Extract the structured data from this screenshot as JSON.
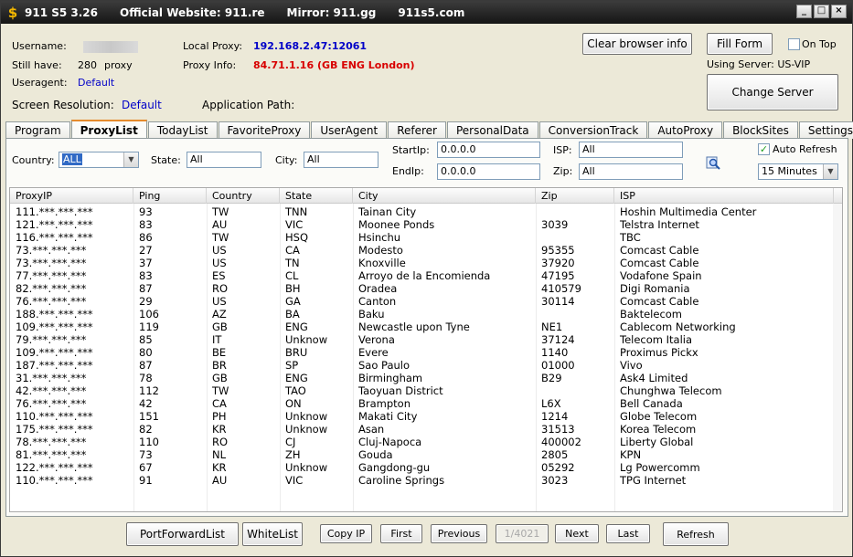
{
  "titlebar": {
    "app": "911 S5 3.26",
    "website": "Official Website:  911.re",
    "mirror": "Mirror:  911.gg",
    "alt": "911s5.com",
    "logo_icon": "dollar-icon"
  },
  "info": {
    "username_label": "Username:",
    "still_have_label": "Still have:",
    "still_have_value": "280",
    "still_have_unit": "proxy",
    "useragent_label": "Useragent:",
    "useragent_value": "Default",
    "local_proxy_label": "Local Proxy:",
    "local_proxy_value": "192.168.2.47:12061",
    "proxy_info_label": "Proxy Info:",
    "proxy_info_value": "84.71.1.16 (GB ENG London)",
    "screen_res_label": "Screen Resolution:",
    "screen_res_value": "Default",
    "app_path_label": "Application Path:",
    "using_server": "Using Server: US-VIP"
  },
  "buttons": {
    "clear_browser": "Clear browser info",
    "fill_form": "Fill Form",
    "on_top": "On Top",
    "change_server": "Change Server"
  },
  "tabs": [
    "Program",
    "ProxyList",
    "TodayList",
    "FavoriteProxy",
    "UserAgent",
    "Referer",
    "PersonalData",
    "ConversionTrack",
    "AutoProxy",
    "BlockSites",
    "Settings"
  ],
  "active_tab": "ProxyList",
  "filters": {
    "country_label": "Country:",
    "country_value": "ALL",
    "state_label": "State:",
    "state_value": "All",
    "city_label": "City:",
    "city_value": "All",
    "startip_label": "StartIp:",
    "startip_value": "0.0.0.0",
    "endip_label": "EndIp:",
    "endip_value": "0.0.0.0",
    "isp_label": "ISP:",
    "isp_value": "All",
    "zip_label": "Zip:",
    "zip_value": "All",
    "auto_refresh_label": "Auto Refresh",
    "auto_refresh_checked": true,
    "interval_value": "15 Minutes",
    "search_icon": "search-icon"
  },
  "table": {
    "columns": [
      "ProxyIP",
      "Ping",
      "Country",
      "State",
      "City",
      "Zip",
      "ISP"
    ],
    "rows": [
      [
        "111.***.***.***",
        "93",
        "TW",
        "TNN",
        "Tainan City",
        "",
        "Hoshin Multimedia Center"
      ],
      [
        "121.***.***.***",
        "83",
        "AU",
        "VIC",
        "Moonee Ponds",
        "3039",
        "Telstra Internet"
      ],
      [
        "116.***.***.***",
        "86",
        "TW",
        "HSQ",
        "Hsinchu",
        "",
        "TBC"
      ],
      [
        "73.***.***.***",
        "27",
        "US",
        "CA",
        "Modesto",
        "95355",
        "Comcast Cable"
      ],
      [
        "73.***.***.***",
        "37",
        "US",
        "TN",
        "Knoxville",
        "37920",
        "Comcast Cable"
      ],
      [
        "77.***.***.***",
        "83",
        "ES",
        "CL",
        "Arroyo de la Encomienda",
        "47195",
        "Vodafone Spain"
      ],
      [
        "82.***.***.***",
        "87",
        "RO",
        "BH",
        "Oradea",
        "410579",
        "Digi Romania"
      ],
      [
        "76.***.***.***",
        "29",
        "US",
        "GA",
        "Canton",
        "30114",
        "Comcast Cable"
      ],
      [
        "188.***.***.***",
        "106",
        "AZ",
        "BA",
        "Baku",
        "",
        "Baktelecom"
      ],
      [
        "109.***.***.***",
        "119",
        "GB",
        "ENG",
        "Newcastle upon Tyne",
        "NE1",
        "Cablecom Networking"
      ],
      [
        "79.***.***.***",
        "85",
        "IT",
        "Unknow",
        "Verona",
        "37124",
        "Telecom Italia"
      ],
      [
        "109.***.***.***",
        "80",
        "BE",
        "BRU",
        "Evere",
        "1140",
        "Proximus Pickx"
      ],
      [
        "187.***.***.***",
        "87",
        "BR",
        "SP",
        "Sao Paulo",
        "01000",
        "Vivo"
      ],
      [
        "31.***.***.***",
        "78",
        "GB",
        "ENG",
        "Birmingham",
        "B29",
        "Ask4 Limited"
      ],
      [
        "42.***.***.***",
        "112",
        "TW",
        "TAO",
        "Taoyuan District",
        "",
        "Chunghwa Telecom"
      ],
      [
        "76.***.***.***",
        "42",
        "CA",
        "ON",
        "Brampton",
        "L6X",
        "Bell Canada"
      ],
      [
        "110.***.***.***",
        "151",
        "PH",
        "Unknow",
        "Makati City",
        "1214",
        "Globe Telecom"
      ],
      [
        "175.***.***.***",
        "82",
        "KR",
        "Unknow",
        "Asan",
        "31513",
        "Korea Telecom"
      ],
      [
        "78.***.***.***",
        "110",
        "RO",
        "CJ",
        "Cluj-Napoca",
        "400002",
        "Liberty Global"
      ],
      [
        "81.***.***.***",
        "73",
        "NL",
        "ZH",
        "Gouda",
        "2805",
        "KPN"
      ],
      [
        "122.***.***.***",
        "67",
        "KR",
        "Unknow",
        "Gangdong-gu",
        "05292",
        "Lg Powercomm"
      ],
      [
        "110.***.***.***",
        "91",
        "AU",
        "VIC",
        "Caroline Springs",
        "3023",
        "TPG Internet"
      ]
    ]
  },
  "bottom": {
    "portforward": "PortForwardList",
    "whitelist": "WhiteList",
    "copy_ip": "Copy IP",
    "first": "First",
    "previous": "Previous",
    "page": "1/4021",
    "next": "Next",
    "last": "Last",
    "refresh": "Refresh"
  }
}
